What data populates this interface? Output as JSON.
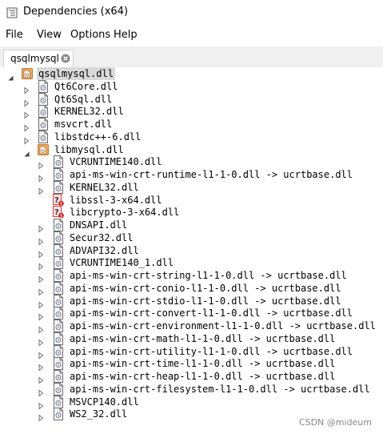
{
  "window": {
    "title": "Dependencies (x64)"
  },
  "menu": {
    "file": "File",
    "view": "View",
    "options": "Options",
    "help": "Help"
  },
  "tab": {
    "label": "qsqlmysql"
  },
  "tree": {
    "root": {
      "label": "qsqlmysql.dll",
      "icon": "folder-dll-icon",
      "expanded": true
    },
    "level1": [
      {
        "label": "Qt6Core.dll",
        "icon": "dll-icon",
        "expanded": false
      },
      {
        "label": "Qt6Sql.dll",
        "icon": "dll-icon",
        "expanded": false
      },
      {
        "label": "KERNEL32.dll",
        "icon": "dll-icon",
        "expanded": false
      },
      {
        "label": "msvcrt.dll",
        "icon": "dll-icon",
        "expanded": false
      },
      {
        "label": "libstdc++-6.dll",
        "icon": "dll-icon",
        "expanded": false
      },
      {
        "label": "libmysql.dll",
        "icon": "folder-dll-icon",
        "expanded": true
      }
    ],
    "level2": [
      {
        "label": "VCRUNTIME140.dll",
        "icon": "dll-icon",
        "missing": false
      },
      {
        "label": "api-ms-win-crt-runtime-l1-1-0.dll -> ucrtbase.dll",
        "icon": "dll-icon",
        "missing": false
      },
      {
        "label": "KERNEL32.dll",
        "icon": "dll-icon",
        "missing": false
      },
      {
        "label": "libssl-3-x64.dll",
        "icon": "missing-dll-icon",
        "missing": true
      },
      {
        "label": "libcrypto-3-x64.dll",
        "icon": "missing-dll-icon",
        "missing": true
      },
      {
        "label": "DNSAPI.dll",
        "icon": "dll-icon",
        "missing": false
      },
      {
        "label": "Secur32.dll",
        "icon": "dll-icon",
        "missing": false
      },
      {
        "label": "ADVAPI32.dll",
        "icon": "dll-icon",
        "missing": false
      },
      {
        "label": "VCRUNTIME140_1.dll",
        "icon": "dll-icon",
        "missing": false
      },
      {
        "label": "api-ms-win-crt-string-l1-1-0.dll -> ucrtbase.dll",
        "icon": "dll-icon",
        "missing": false
      },
      {
        "label": "api-ms-win-crt-conio-l1-1-0.dll -> ucrtbase.dll",
        "icon": "dll-icon",
        "missing": false
      },
      {
        "label": "api-ms-win-crt-stdio-l1-1-0.dll -> ucrtbase.dll",
        "icon": "dll-icon",
        "missing": false
      },
      {
        "label": "api-ms-win-crt-convert-l1-1-0.dll -> ucrtbase.dll",
        "icon": "dll-icon",
        "missing": false
      },
      {
        "label": "api-ms-win-crt-environment-l1-1-0.dll -> ucrtbase.dll",
        "icon": "dll-icon",
        "missing": false
      },
      {
        "label": "api-ms-win-crt-math-l1-1-0.dll -> ucrtbase.dll",
        "icon": "dll-icon",
        "missing": false
      },
      {
        "label": "api-ms-win-crt-utility-l1-1-0.dll -> ucrtbase.dll",
        "icon": "dll-icon",
        "missing": false
      },
      {
        "label": "api-ms-win-crt-time-l1-1-0.dll -> ucrtbase.dll",
        "icon": "dll-icon",
        "missing": false
      },
      {
        "label": "api-ms-win-crt-heap-l1-1-0.dll -> ucrtbase.dll",
        "icon": "dll-icon",
        "missing": false
      },
      {
        "label": "api-ms-win-crt-filesystem-l1-1-0.dll -> ucrtbase.dll",
        "icon": "dll-icon",
        "missing": false
      },
      {
        "label": "MSVCP140.dll",
        "icon": "dll-icon",
        "missing": false
      },
      {
        "label": "WS2_32.dll",
        "icon": "dll-icon",
        "missing": false
      }
    ]
  },
  "watermark": "CSDN @mideum",
  "colors": {
    "selection": "#d9d9d9",
    "folder": "#f0a85a",
    "missing": "#e02020",
    "tab_strip": "#f0f0f0"
  }
}
